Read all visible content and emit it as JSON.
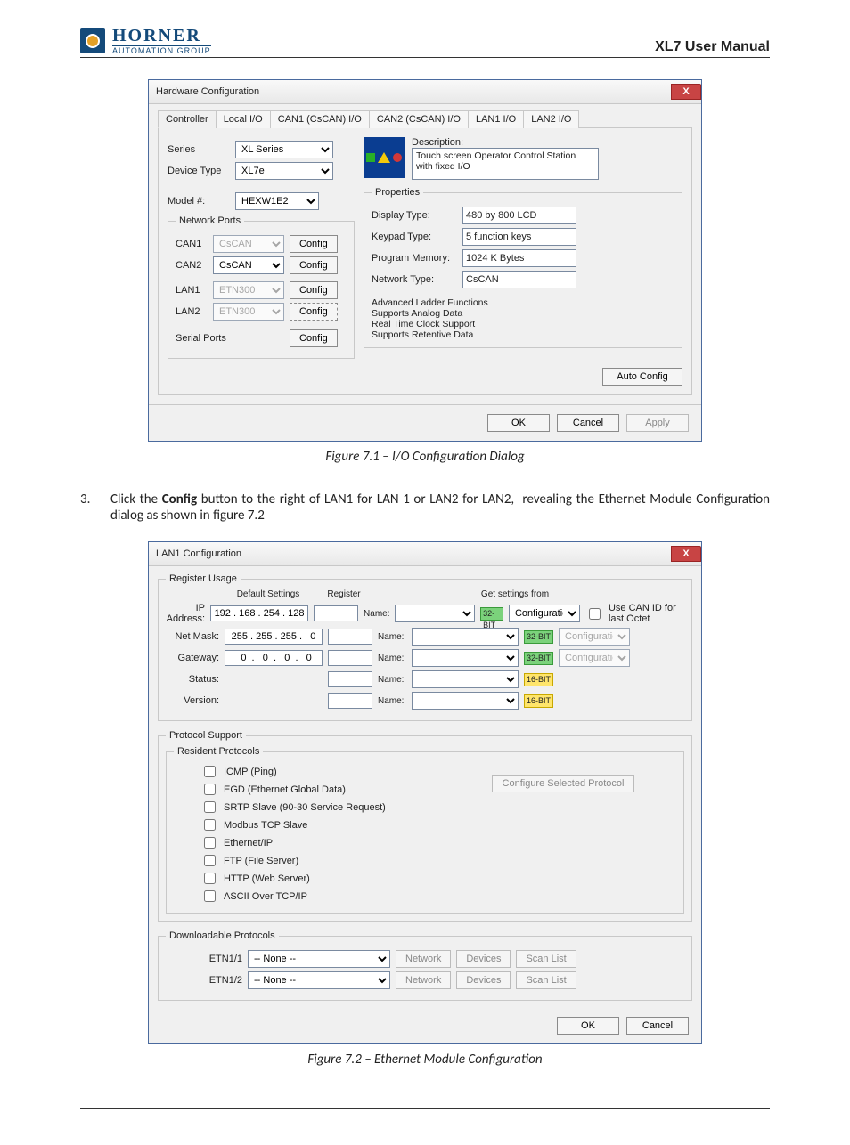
{
  "header": {
    "brand_top": "HORNER",
    "brand_bottom": "AUTOMATION GROUP",
    "manual": "XL7 User Manual"
  },
  "dialog1": {
    "title": "Hardware Configuration",
    "close": "X",
    "tabs": [
      "Controller",
      "Local I/O",
      "CAN1 (CsCAN) I/O",
      "CAN2 (CsCAN) I/O",
      "LAN1 I/O",
      "LAN2 I/O"
    ],
    "series_lbl": "Series",
    "series_val": "XL Series",
    "device_type_lbl": "Device Type",
    "device_type_val": "XL7e",
    "model_lbl": "Model #:",
    "model_val": "HEXW1E2",
    "network_ports_legend": "Network Ports",
    "can1_lbl": "CAN1",
    "can1_val": "CsCAN",
    "can2_lbl": "CAN2",
    "can2_val": "CsCAN",
    "lan1_lbl": "LAN1",
    "lan1_val": "ETN300",
    "lan2_lbl": "LAN2",
    "lan2_val": "ETN300",
    "serial_ports_lbl": "Serial Ports",
    "config_btn": "Config",
    "desc_lbl": "Description:",
    "desc_val": "Touch screen Operator Control Station with fixed I/O",
    "props_legend": "Properties",
    "disp_type_lbl": "Display Type:",
    "disp_type_val": "480 by 800 LCD",
    "keypad_lbl": "Keypad Type:",
    "keypad_val": "5 function keys",
    "progmem_lbl": "Program Memory:",
    "progmem_val": "1024 K Bytes",
    "nettype_lbl": "Network Type:",
    "nettype_val": "CsCAN",
    "features": "Advanced Ladder Functions\nSupports Analog Data\nReal Time Clock Support\nSupports Retentive Data",
    "auto_config": "Auto Config",
    "ok": "OK",
    "cancel": "Cancel",
    "apply": "Apply"
  },
  "caption1": "Figure 7.1 – I/O Configuration Dialog",
  "step3_num": "3.",
  "step3_text": "Click the <b>Config</b> button to the right of LAN1 for LAN 1 or LAN2 for LAN2,&nbsp; revealing the Ethernet Module Configuration dialog as shown in figure 7.2",
  "dialog2": {
    "title": "LAN1 Configuration",
    "close": "X",
    "reg_usage_legend": "Register Usage",
    "default_settings_hdr": "Default Settings",
    "register_hdr": "Register",
    "get_settings_hdr": "Get settings from",
    "ip_lbl": "IP Address:",
    "ip_val": "192 . 168 . 254 . 128",
    "mask_lbl": "Net Mask:",
    "mask_val": "255 . 255 . 255 .   0",
    "gw_lbl": "Gateway:",
    "gw_val": "  0  .   0  .   0  .   0",
    "status_lbl": "Status:",
    "version_lbl": "Version:",
    "name_lbl": "Name:",
    "tag32": "32-BIT",
    "tag16": "16-BIT",
    "cfg_src": "Configuration",
    "use_canid_lbl": "Use CAN ID for last Octet",
    "prot_support_legend": "Protocol Support",
    "resident_legend": "Resident Protocols",
    "protocols": [
      "ICMP (Ping)",
      "EGD (Ethernet Global Data)",
      "SRTP Slave (90-30 Service Request)",
      "Modbus TCP Slave",
      "Ethernet/IP",
      "FTP (File Server)",
      "HTTP (Web Server)",
      "ASCII Over TCP/IP"
    ],
    "cfg_sel_prot": "Configure Selected Protocol",
    "dl_prot_legend": "Downloadable Protocols",
    "etn11_lbl": "ETN1/1",
    "etn12_lbl": "ETN1/2",
    "none_val": "-- None --",
    "network_btn": "Network",
    "devices_btn": "Devices",
    "scanlist_btn": "Scan List",
    "ok": "OK",
    "cancel": "Cancel"
  },
  "caption2": "Figure 7.2 – Ethernet Module Configuration"
}
